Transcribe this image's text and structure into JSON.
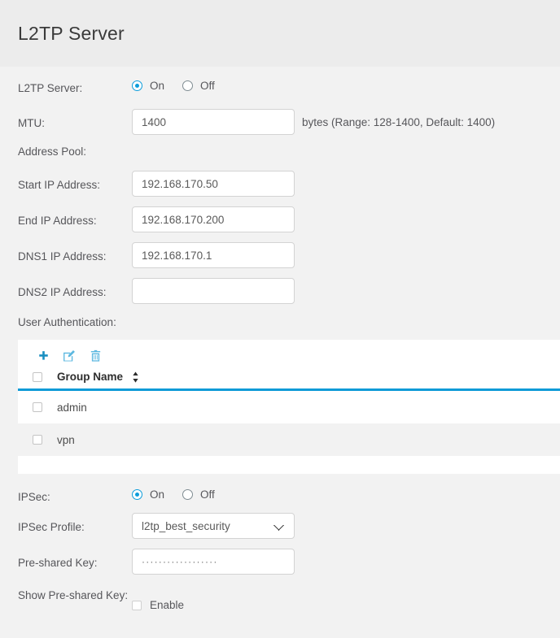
{
  "header": {
    "title": "L2TP Server"
  },
  "colors": {
    "accent_blue": "#0f9bd7",
    "radio_blue": "#0d9ddb",
    "icon_blue": "#1a8fc1",
    "icon_blue_light": "#5cb8e0",
    "page_bg": "#f2f2f2",
    "header_bg": "#ececec",
    "row_alt_bg": "#f2f2f2"
  },
  "form": {
    "l2tp_server": {
      "label": "L2TP Server:",
      "options": [
        "On",
        "Off"
      ],
      "selected": "On"
    },
    "mtu": {
      "label": "MTU:",
      "value": "1400",
      "suffix": "bytes (Range: 128-1400, Default: 1400)"
    },
    "address_pool": {
      "label": "Address Pool:"
    },
    "start_ip": {
      "label": "Start IP Address:",
      "value": "192.168.170.50"
    },
    "end_ip": {
      "label": "End IP Address:",
      "value": "192.168.170.200"
    },
    "dns1_ip": {
      "label": "DNS1 IP Address:",
      "value": "192.168.170.1"
    },
    "dns2_ip": {
      "label": "DNS2 IP Address:",
      "value": ""
    },
    "user_authentication": {
      "label": "User Authentication:"
    },
    "ipsec": {
      "label": "IPSec:",
      "options": [
        "On",
        "Off"
      ],
      "selected": "On"
    },
    "ipsec_profile": {
      "label": "IPSec Profile:",
      "selected": "l2tp_best_security",
      "options": [
        "l2tp_best_security"
      ]
    },
    "preshared_key": {
      "label": "Pre-shared Key:",
      "value": "··················"
    },
    "show_preshared_key": {
      "label": "Show Pre-shared Key:",
      "checkbox_label": "Enable",
      "checked": false
    }
  },
  "user_table": {
    "toolbar": {
      "add_icon": "plus-icon",
      "edit_icon": "edit-icon",
      "delete_icon": "trash-icon"
    },
    "columns": [
      "Group Name"
    ],
    "sort_icon": "sort-updown-icon",
    "rows": [
      {
        "group_name": "admin",
        "selected": false
      },
      {
        "group_name": "vpn",
        "selected": false
      }
    ]
  }
}
